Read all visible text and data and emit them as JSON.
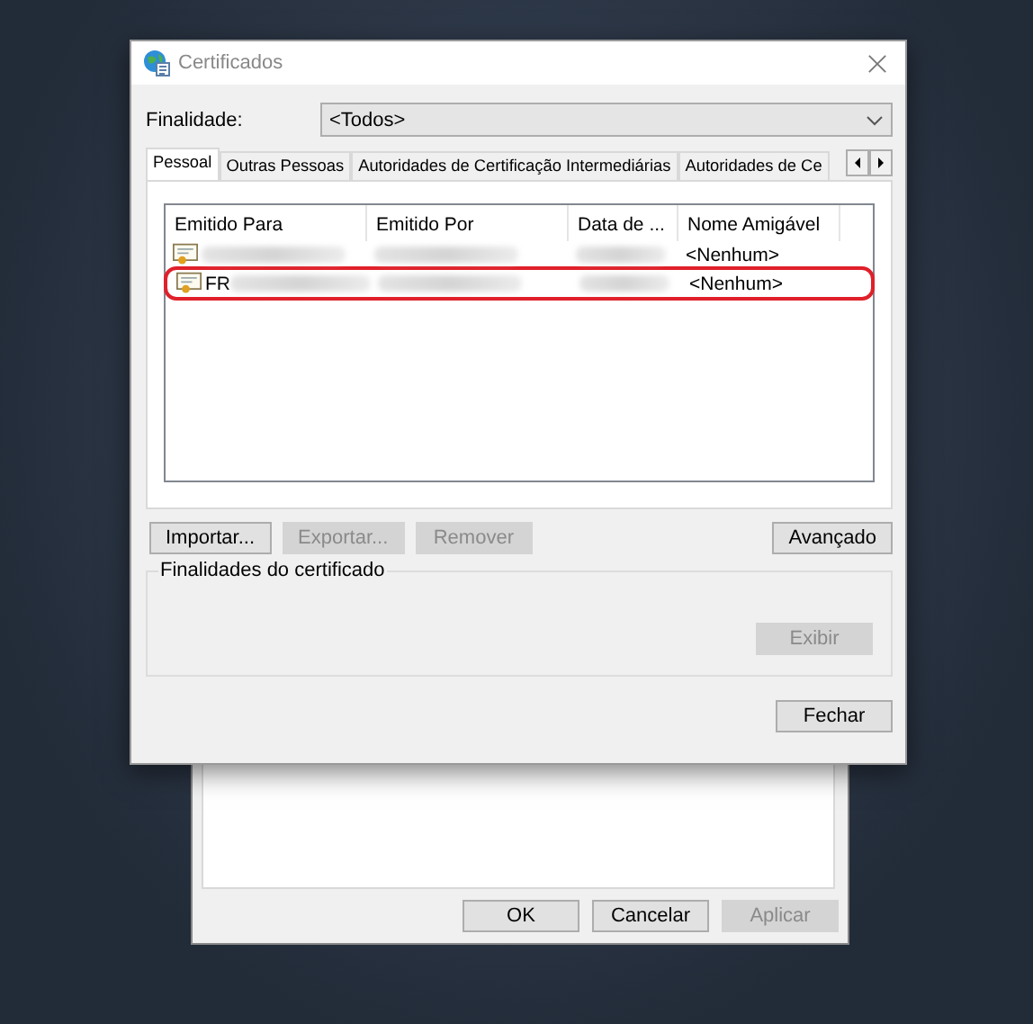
{
  "back_dialog": {
    "buttons": [
      {
        "label": "OK",
        "disabled": false
      },
      {
        "label": "Cancelar",
        "disabled": false
      },
      {
        "label": "Aplicar",
        "disabled": true
      }
    ]
  },
  "window": {
    "title": "Certificados"
  },
  "purpose": {
    "label": "Finalidade:",
    "value": "<Todos>"
  },
  "tabs": [
    {
      "label": "Pessoal",
      "selected": true
    },
    {
      "label": "Outras Pessoas",
      "selected": false
    },
    {
      "label": "Autoridades de Certificação Intermediárias",
      "selected": false
    },
    {
      "label": "Autoridades de Ce",
      "selected": false
    }
  ],
  "list": {
    "columns": [
      "Emitido Para",
      "Emitido Por",
      "Data de ...",
      "Nome Amigável"
    ],
    "rows": [
      {
        "highlighted": false,
        "cells": [
          {
            "kind": "redacted"
          },
          {
            "kind": "redacted"
          },
          {
            "kind": "redacted"
          },
          {
            "kind": "text",
            "text": "<Nenhum>"
          }
        ]
      },
      {
        "highlighted": true,
        "cells": [
          {
            "kind": "partial",
            "text": "FR"
          },
          {
            "kind": "redacted"
          },
          {
            "kind": "redacted"
          },
          {
            "kind": "text",
            "text": "<Nenhum>"
          }
        ]
      }
    ]
  },
  "actions": [
    {
      "label": "Importar...",
      "disabled": false
    },
    {
      "label": "Exportar...",
      "disabled": true
    },
    {
      "label": "Remover",
      "disabled": true
    }
  ],
  "advanced_button": {
    "label": "Avançado",
    "disabled": false
  },
  "purposes_group": {
    "title": "Finalidades do certificado",
    "button": {
      "label": "Exibir",
      "disabled": true
    }
  },
  "close_button": {
    "label": "Fechar",
    "disabled": false
  }
}
